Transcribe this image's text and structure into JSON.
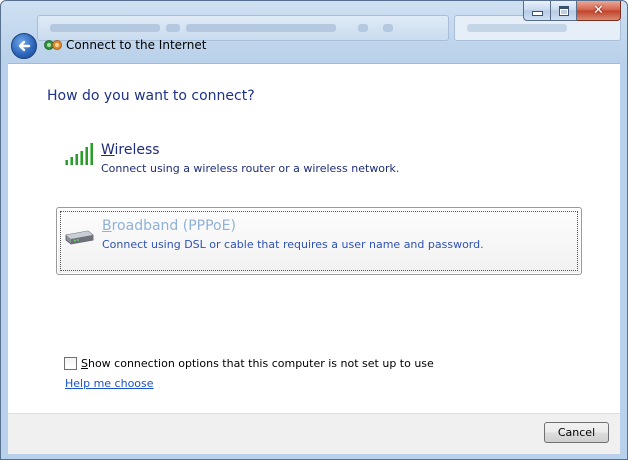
{
  "window": {
    "title": "Connect to the Internet",
    "close_glyph": "✕"
  },
  "main": {
    "heading": "How do you want to connect?",
    "options": [
      {
        "title_first": "W",
        "title_rest": "ireless",
        "description": "Connect using a wireless router or a wireless network.",
        "icon": "wireless-signal-icon"
      },
      {
        "title_first": "B",
        "title_rest": "roadband (PPPoE)",
        "description": "Connect using DSL or cable that requires a user name and password.",
        "icon": "broadband-modem-icon"
      }
    ],
    "show_options_checkbox": {
      "label_first": "S",
      "label_rest": "how connection options that this computer is not set up to use",
      "checked": false
    },
    "help_link": "Help me choose"
  },
  "footer": {
    "cancel_label": "Cancel"
  },
  "colors": {
    "heading": "#1e3287",
    "link": "#1a52c9",
    "disabled_title": "#8fb2d8"
  }
}
